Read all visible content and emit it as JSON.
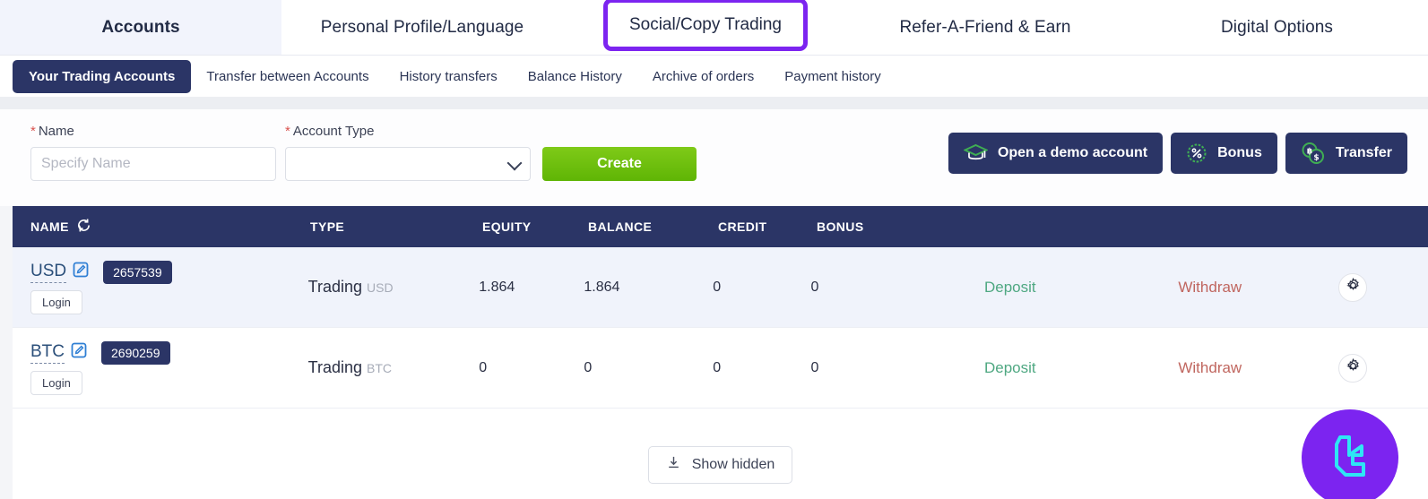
{
  "topnav": {
    "items": [
      {
        "label": "Accounts",
        "active": true
      },
      {
        "label": "Personal Profile/Language",
        "active": false
      },
      {
        "label": "Social/Copy Trading",
        "active": false,
        "highlighted": true
      },
      {
        "label": "Refer-A-Friend & Earn",
        "active": false
      },
      {
        "label": "Digital Options",
        "active": false
      }
    ],
    "highlight_color": "#7c24f0"
  },
  "subtabs": {
    "items": [
      {
        "label": "Your Trading Accounts",
        "active": true
      },
      {
        "label": "Transfer between Accounts",
        "active": false
      },
      {
        "label": "History transfers",
        "active": false
      },
      {
        "label": "Balance History",
        "active": false
      },
      {
        "label": "Archive of orders",
        "active": false
      },
      {
        "label": "Payment history",
        "active": false
      }
    ]
  },
  "create_form": {
    "name_label": "Name",
    "name_required_mark": "*",
    "name_placeholder": "Specify Name",
    "name_value": "",
    "account_type_label": "Account Type",
    "account_type_required_mark": "*",
    "account_type_value": "",
    "create_button": "Create"
  },
  "actions": {
    "demo_label": "Open a demo account",
    "demo_icon": "graduation-cap-icon",
    "bonus_label": "Bonus",
    "bonus_icon": "percent-badge-icon",
    "transfer_label": "Transfer",
    "transfer_icon": "btc-usd-coins-icon",
    "button_color": "#2b3566",
    "icon_color": "#3fae53"
  },
  "table": {
    "columns": {
      "name": "NAME",
      "name_icon": "refresh-icon",
      "type": "TYPE",
      "equity": "EQUITY",
      "balance": "BALANCE",
      "credit": "CREDIT",
      "bonus": "BONUS"
    },
    "rows": [
      {
        "currency": "USD",
        "edit_icon": "edit-pencil-icon",
        "account_id": "2657539",
        "login_label": "Login",
        "type": "Trading",
        "type_currency": "USD",
        "equity": "1.864",
        "balance": "1.864",
        "credit": "0",
        "bonus": "0",
        "deposit_label": "Deposit",
        "withdraw_label": "Withdraw",
        "settings_icon": "gear-icon"
      },
      {
        "currency": "BTC",
        "edit_icon": "edit-pencil-icon",
        "account_id": "2690259",
        "login_label": "Login",
        "type": "Trading",
        "type_currency": "BTC",
        "equity": "0",
        "balance": "0",
        "credit": "0",
        "bonus": "0",
        "deposit_label": "Deposit",
        "withdraw_label": "Withdraw",
        "settings_icon": "gear-icon"
      }
    ],
    "deposit_color": "#4fa882",
    "withdraw_color": "#c0665f",
    "header_color": "#2b3566"
  },
  "footer": {
    "show_hidden_label": "Show hidden",
    "show_hidden_icon": "download-tray-icon"
  },
  "chat_widget": {
    "icon": "support-chat-logo-icon",
    "background": "#7c24f0",
    "glyph_color": "#2ee6f5"
  }
}
